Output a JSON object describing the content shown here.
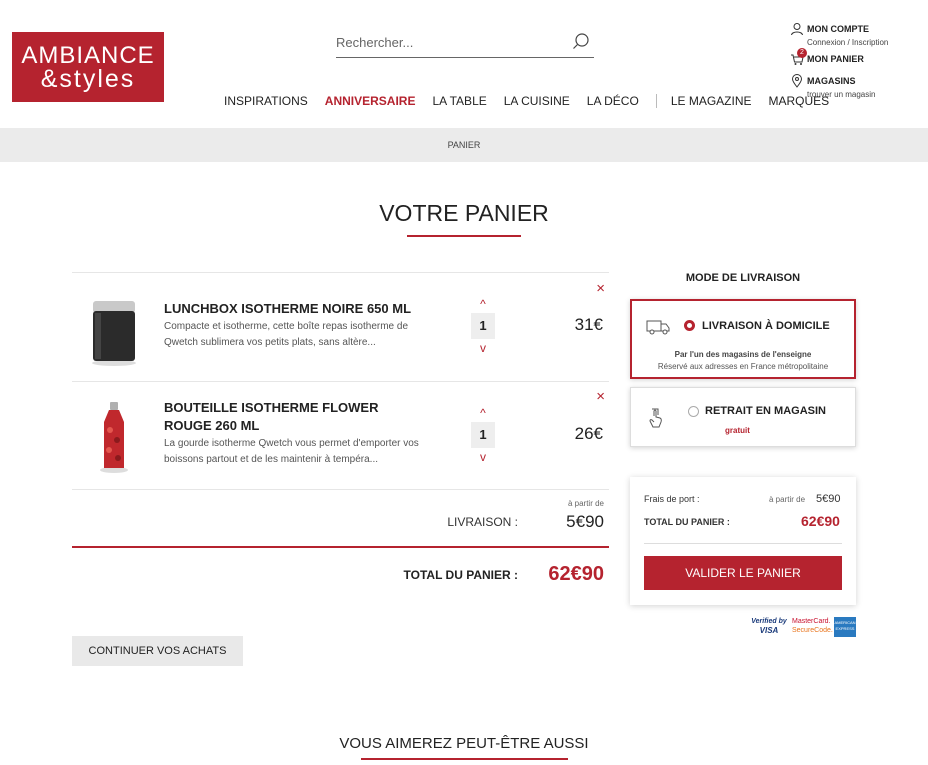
{
  "brand": {
    "line1": "AMBIANCE",
    "line2": "&styles",
    "color": "#b5232f"
  },
  "search": {
    "placeholder": "Rechercher..."
  },
  "account": {
    "my_account": "MON COMPTE",
    "login_links": "Connexion / Inscription",
    "my_cart": "MON PANIER",
    "cart_count": "2",
    "stores": "MAGASINS",
    "find_store": "trouver un magasin"
  },
  "nav": {
    "items": [
      "INSPIRATIONS",
      "ANNIVERSAIRE",
      "LA TABLE",
      "LA CUISINE",
      "LA DÉCO",
      "LE MAGAZINE",
      "MARQUES"
    ]
  },
  "breadcrumb": "PANIER",
  "page_title": "VOTRE PANIER",
  "cart": {
    "items": [
      {
        "name": "LUNCHBOX ISOTHERME NOIRE 650 ML",
        "description": "Compacte et isotherme, cette boîte repas isotherme de Qwetch sublimera vos petits plats, sans altère...",
        "quantity": "1",
        "price": "31€",
        "remove": "×"
      },
      {
        "name": "BOUTEILLE ISOTHERME FLOWER ROUGE 260 ML",
        "description": "La gourde isotherme Qwetch vous permet d'emporter vos boissons partout et de les maintenir à tempéra...",
        "quantity": "1",
        "price": "26€",
        "remove": "×"
      }
    ],
    "delivery_from": "à partir de",
    "delivery_label": "LIVRAISON :",
    "delivery_price": "5€90",
    "total_label": "TOTAL DU PANIER :",
    "total_price": "62€90",
    "continue_label": "CONTINUER VOS ACHATS"
  },
  "delivery": {
    "title": "MODE DE LIVRAISON",
    "options": [
      {
        "label": "LIVRAISON À DOMICILE",
        "line1": "Par l'un des magasins de l'enseigne",
        "line2": "Réservé aux adresses en France métropolitaine",
        "selected": true
      },
      {
        "label": "RETRAIT EN MAGASIN",
        "line1": "gratuit",
        "selected": false
      }
    ]
  },
  "summary": {
    "shipping_label": "Frais de port :",
    "shipping_from": "à partir de",
    "shipping_price": "5€90",
    "total_label": "TOTAL DU PANIER :",
    "total_price": "62€90",
    "validate_label": "VALIDER LE PANIER"
  },
  "payment": {
    "verified_top": "Verified",
    "verified_by": "by",
    "visa": "VISA",
    "mc_top": "MasterCard.",
    "mc_bottom": "SecureCode.",
    "amex": "AMERICAN EXPRESS"
  },
  "suggest_title": "VOUS AIMEREZ PEUT-ÊTRE AUSSI"
}
